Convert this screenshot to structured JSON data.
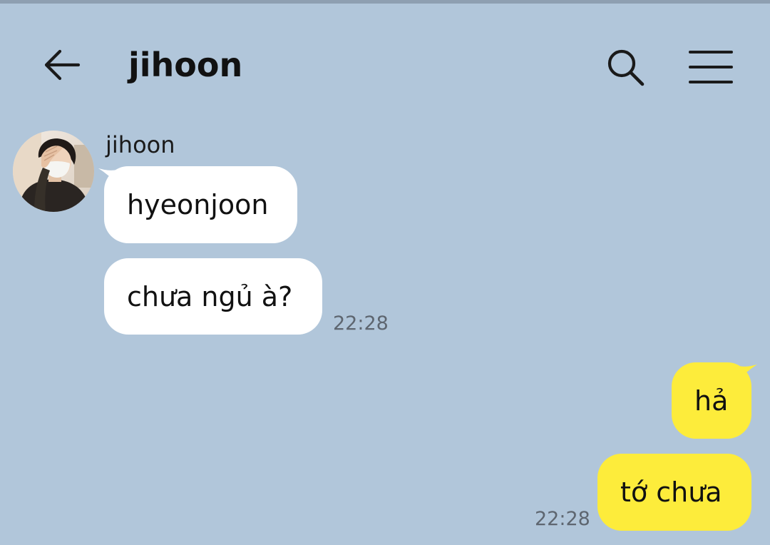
{
  "header": {
    "title": "jihoon",
    "back_icon": "arrow-left-icon",
    "search_icon": "search-icon",
    "menu_icon": "hamburger-menu-icon"
  },
  "conversation": {
    "contact_name": "jihoon",
    "incoming": [
      {
        "text": "hyeonjoon"
      },
      {
        "text": "chưa ngủ à?",
        "time": "22:28"
      }
    ],
    "outgoing": [
      {
        "text": "hả"
      },
      {
        "text": "tớ chưa",
        "time": "22:28"
      }
    ]
  },
  "colors": {
    "background": "#b1c6da",
    "incoming_bubble": "#ffffff",
    "outgoing_bubble": "#fdec3b"
  }
}
